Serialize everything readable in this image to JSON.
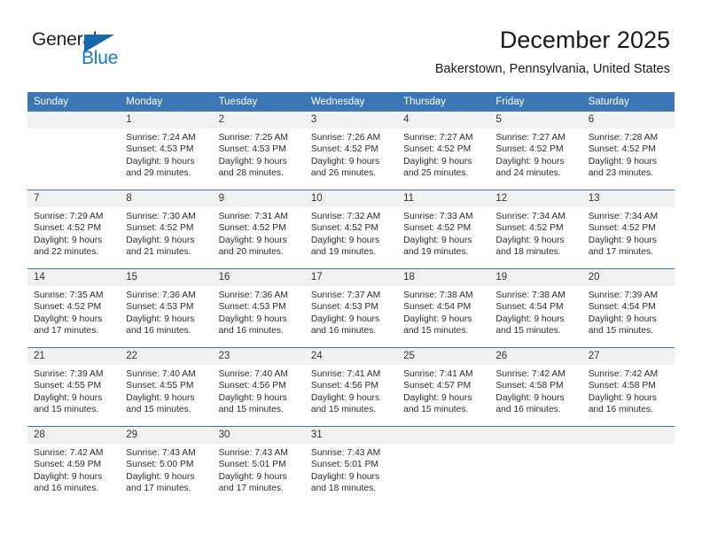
{
  "brand": {
    "name_part1": "General",
    "name_part2": "Blue",
    "triangle_icon": "triangle-icon",
    "accent_color": "#1767ae",
    "text_color": "#231f20"
  },
  "header": {
    "title": "December 2025",
    "location": "Bakerstown, Pennsylvania, United States"
  },
  "calendar": {
    "header_bg": "#3b77b5",
    "daynum_bg": "#f1f1f1",
    "weekday_headers": [
      "Sunday",
      "Monday",
      "Tuesday",
      "Wednesday",
      "Thursday",
      "Friday",
      "Saturday"
    ],
    "weeks": [
      [
        {
          "day": "",
          "lines": []
        },
        {
          "day": "1",
          "lines": [
            "Sunrise: 7:24 AM",
            "Sunset: 4:53 PM",
            "Daylight: 9 hours",
            "and 29 minutes."
          ]
        },
        {
          "day": "2",
          "lines": [
            "Sunrise: 7:25 AM",
            "Sunset: 4:53 PM",
            "Daylight: 9 hours",
            "and 28 minutes."
          ]
        },
        {
          "day": "3",
          "lines": [
            "Sunrise: 7:26 AM",
            "Sunset: 4:52 PM",
            "Daylight: 9 hours",
            "and 26 minutes."
          ]
        },
        {
          "day": "4",
          "lines": [
            "Sunrise: 7:27 AM",
            "Sunset: 4:52 PM",
            "Daylight: 9 hours",
            "and 25 minutes."
          ]
        },
        {
          "day": "5",
          "lines": [
            "Sunrise: 7:27 AM",
            "Sunset: 4:52 PM",
            "Daylight: 9 hours",
            "and 24 minutes."
          ]
        },
        {
          "day": "6",
          "lines": [
            "Sunrise: 7:28 AM",
            "Sunset: 4:52 PM",
            "Daylight: 9 hours",
            "and 23 minutes."
          ]
        }
      ],
      [
        {
          "day": "7",
          "lines": [
            "Sunrise: 7:29 AM",
            "Sunset: 4:52 PM",
            "Daylight: 9 hours",
            "and 22 minutes."
          ]
        },
        {
          "day": "8",
          "lines": [
            "Sunrise: 7:30 AM",
            "Sunset: 4:52 PM",
            "Daylight: 9 hours",
            "and 21 minutes."
          ]
        },
        {
          "day": "9",
          "lines": [
            "Sunrise: 7:31 AM",
            "Sunset: 4:52 PM",
            "Daylight: 9 hours",
            "and 20 minutes."
          ]
        },
        {
          "day": "10",
          "lines": [
            "Sunrise: 7:32 AM",
            "Sunset: 4:52 PM",
            "Daylight: 9 hours",
            "and 19 minutes."
          ]
        },
        {
          "day": "11",
          "lines": [
            "Sunrise: 7:33 AM",
            "Sunset: 4:52 PM",
            "Daylight: 9 hours",
            "and 19 minutes."
          ]
        },
        {
          "day": "12",
          "lines": [
            "Sunrise: 7:34 AM",
            "Sunset: 4:52 PM",
            "Daylight: 9 hours",
            "and 18 minutes."
          ]
        },
        {
          "day": "13",
          "lines": [
            "Sunrise: 7:34 AM",
            "Sunset: 4:52 PM",
            "Daylight: 9 hours",
            "and 17 minutes."
          ]
        }
      ],
      [
        {
          "day": "14",
          "lines": [
            "Sunrise: 7:35 AM",
            "Sunset: 4:52 PM",
            "Daylight: 9 hours",
            "and 17 minutes."
          ]
        },
        {
          "day": "15",
          "lines": [
            "Sunrise: 7:36 AM",
            "Sunset: 4:53 PM",
            "Daylight: 9 hours",
            "and 16 minutes."
          ]
        },
        {
          "day": "16",
          "lines": [
            "Sunrise: 7:36 AM",
            "Sunset: 4:53 PM",
            "Daylight: 9 hours",
            "and 16 minutes."
          ]
        },
        {
          "day": "17",
          "lines": [
            "Sunrise: 7:37 AM",
            "Sunset: 4:53 PM",
            "Daylight: 9 hours",
            "and 16 minutes."
          ]
        },
        {
          "day": "18",
          "lines": [
            "Sunrise: 7:38 AM",
            "Sunset: 4:54 PM",
            "Daylight: 9 hours",
            "and 15 minutes."
          ]
        },
        {
          "day": "19",
          "lines": [
            "Sunrise: 7:38 AM",
            "Sunset: 4:54 PM",
            "Daylight: 9 hours",
            "and 15 minutes."
          ]
        },
        {
          "day": "20",
          "lines": [
            "Sunrise: 7:39 AM",
            "Sunset: 4:54 PM",
            "Daylight: 9 hours",
            "and 15 minutes."
          ]
        }
      ],
      [
        {
          "day": "21",
          "lines": [
            "Sunrise: 7:39 AM",
            "Sunset: 4:55 PM",
            "Daylight: 9 hours",
            "and 15 minutes."
          ]
        },
        {
          "day": "22",
          "lines": [
            "Sunrise: 7:40 AM",
            "Sunset: 4:55 PM",
            "Daylight: 9 hours",
            "and 15 minutes."
          ]
        },
        {
          "day": "23",
          "lines": [
            "Sunrise: 7:40 AM",
            "Sunset: 4:56 PM",
            "Daylight: 9 hours",
            "and 15 minutes."
          ]
        },
        {
          "day": "24",
          "lines": [
            "Sunrise: 7:41 AM",
            "Sunset: 4:56 PM",
            "Daylight: 9 hours",
            "and 15 minutes."
          ]
        },
        {
          "day": "25",
          "lines": [
            "Sunrise: 7:41 AM",
            "Sunset: 4:57 PM",
            "Daylight: 9 hours",
            "and 15 minutes."
          ]
        },
        {
          "day": "26",
          "lines": [
            "Sunrise: 7:42 AM",
            "Sunset: 4:58 PM",
            "Daylight: 9 hours",
            "and 16 minutes."
          ]
        },
        {
          "day": "27",
          "lines": [
            "Sunrise: 7:42 AM",
            "Sunset: 4:58 PM",
            "Daylight: 9 hours",
            "and 16 minutes."
          ]
        }
      ],
      [
        {
          "day": "28",
          "lines": [
            "Sunrise: 7:42 AM",
            "Sunset: 4:59 PM",
            "Daylight: 9 hours",
            "and 16 minutes."
          ]
        },
        {
          "day": "29",
          "lines": [
            "Sunrise: 7:43 AM",
            "Sunset: 5:00 PM",
            "Daylight: 9 hours",
            "and 17 minutes."
          ]
        },
        {
          "day": "30",
          "lines": [
            "Sunrise: 7:43 AM",
            "Sunset: 5:01 PM",
            "Daylight: 9 hours",
            "and 17 minutes."
          ]
        },
        {
          "day": "31",
          "lines": [
            "Sunrise: 7:43 AM",
            "Sunset: 5:01 PM",
            "Daylight: 9 hours",
            "and 18 minutes."
          ]
        },
        {
          "day": "",
          "lines": []
        },
        {
          "day": "",
          "lines": []
        },
        {
          "day": "",
          "lines": []
        }
      ]
    ]
  }
}
